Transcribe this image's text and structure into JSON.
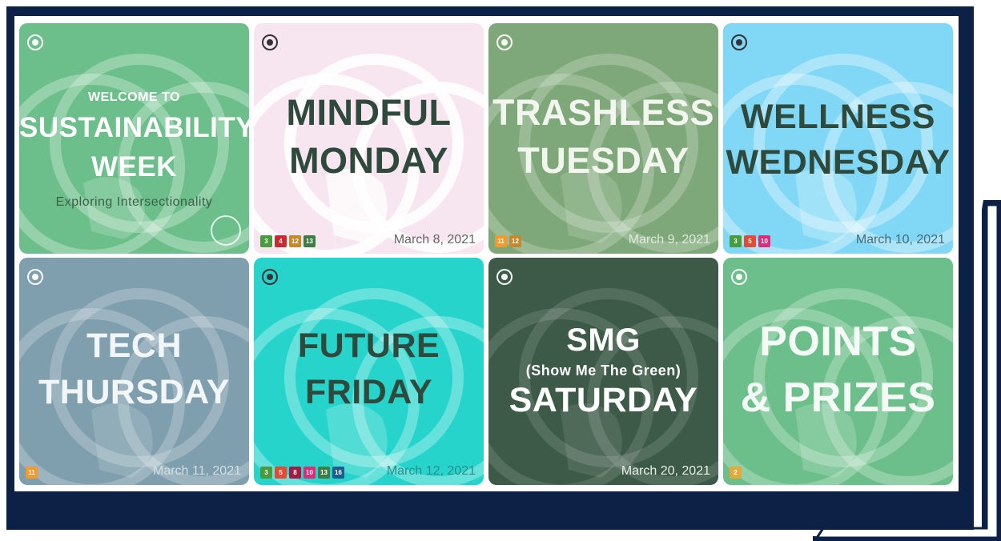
{
  "tiles": [
    {
      "id": "welcome",
      "kicker": "WELCOME TO",
      "line1": "SUSTAINABILITY",
      "line2": "WEEK",
      "subtitle": "Exploring Intersectionality",
      "date": "",
      "badges": [],
      "color": "#6cbf8a"
    },
    {
      "id": "monday",
      "line1": "MINDFUL",
      "line2": "MONDAY",
      "date": "March 8, 2021",
      "badges": [
        "3",
        "4",
        "12",
        "13"
      ],
      "color": "#f7e6ef"
    },
    {
      "id": "tuesday",
      "line1": "TRASHLESS",
      "line2": "TUESDAY",
      "date": "March 9, 2021",
      "badges": [
        "11",
        "12"
      ],
      "color": "#7ea879"
    },
    {
      "id": "wednesday",
      "line1": "WELLNESS",
      "line2": "WEDNESDAY",
      "date": "March 10, 2021",
      "badges": [
        "3",
        "5",
        "10"
      ],
      "color": "#80d8f6"
    },
    {
      "id": "thursday",
      "line1": "TECH",
      "line2": "THURSDAY",
      "date": "March 11, 2021",
      "badges": [
        "11"
      ],
      "color": "#7f9fae"
    },
    {
      "id": "friday",
      "line1": "FUTURE",
      "line2": "FRIDAY",
      "date": "March 12, 2021",
      "badges": [
        "3",
        "5",
        "8",
        "10",
        "13",
        "16"
      ],
      "color": "#26d4cc"
    },
    {
      "id": "saturday",
      "line1": "SMG",
      "middle": "(Show Me The Green)",
      "line2": "SATURDAY",
      "date": "March 20, 2021",
      "badges": [],
      "color": "#3d5a48"
    },
    {
      "id": "points",
      "line1": "POINTS",
      "line2": "& PRIZES",
      "date": "",
      "badges": [
        "2"
      ],
      "color": "#6cbf8a"
    }
  ],
  "badge_colors": {
    "2": "#e5a93b",
    "3": "#4a9b3e",
    "4": "#c62b31",
    "5": "#e34b36",
    "8": "#a21c44",
    "10": "#dd2a79",
    "11": "#f29a2e",
    "12": "#c28a2c",
    "13": "#3f7d45",
    "16": "#1c5d8f"
  },
  "colors": {
    "navy": "#0d2147",
    "dark_text": "#2f4a3d",
    "light_text": "#ffffff"
  }
}
